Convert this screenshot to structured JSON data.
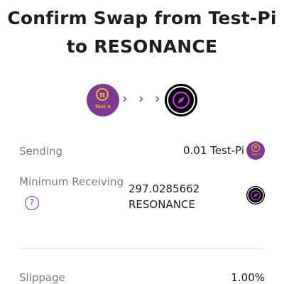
{
  "header": {
    "title_line1": "Confirm Swap from Test-Pi",
    "title_line2": "to RESONANCE"
  },
  "tokens": {
    "from": {
      "symbol": "Test-Pi",
      "icon": "pi-coin-icon",
      "icon_caption": "Test π",
      "icon_glyph": "π",
      "color": "#7b3a8f"
    },
    "to": {
      "symbol": "RESONANCE",
      "icon": "resonance-compass-icon",
      "color": "#000000",
      "accent": "#b93fd9"
    },
    "arrows": [
      "›",
      "›",
      "›"
    ]
  },
  "details": {
    "sending_label": "Sending",
    "sending_value": "0.01 Test-Pi",
    "min_receiving_label": "Minimum Receiving",
    "min_receiving_amount": "297.0285662",
    "min_receiving_symbol": "RESONANCE",
    "help_glyph": "?",
    "slippage_label": "Slippage",
    "slippage_value": "1.00%"
  }
}
